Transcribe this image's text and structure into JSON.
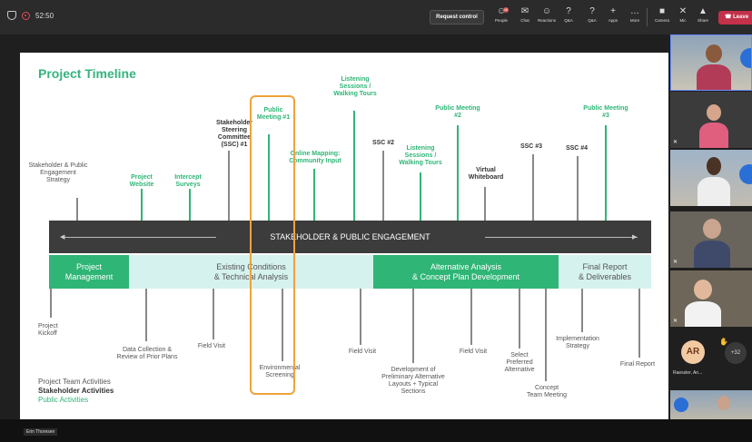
{
  "topbar": {
    "timer": "52:50",
    "request_control": "Request control",
    "buttons": [
      {
        "label": "People",
        "icon": "people-icon",
        "glyph": "☺",
        "badge": "40"
      },
      {
        "label": "Chat",
        "icon": "chat-icon",
        "glyph": "✉"
      },
      {
        "label": "Reactions",
        "icon": "reactions-icon",
        "glyph": "☺"
      },
      {
        "label": "Q&A",
        "icon": "qa-icon",
        "glyph": "?"
      },
      {
        "label": "Q&A",
        "icon": "qa-icon",
        "glyph": "?"
      },
      {
        "label": "Apps",
        "icon": "apps-icon",
        "glyph": "+"
      },
      {
        "label": "More",
        "icon": "more-icon",
        "glyph": "…"
      },
      {
        "label": "Camera",
        "icon": "camera-icon",
        "glyph": "■"
      },
      {
        "label": "Mic",
        "icon": "mic-off-icon",
        "glyph": "✕"
      },
      {
        "label": "Share",
        "icon": "share-icon",
        "glyph": "▲"
      }
    ],
    "leave": "Leave"
  },
  "slide": {
    "title": "Project Timeline",
    "band_text": "STAKEHOLDER & PUBLIC ENGAGEMENT",
    "above": [
      {
        "text": "Stakeholder & Public\nEngagement\nStrategy",
        "style": "n"
      },
      {
        "text": "Project\nWebsite",
        "style": "g"
      },
      {
        "text": "Intercept\nSurveys",
        "style": "g"
      },
      {
        "text": "Stakeholder\nSteering\nCommittee\n(SSC) #1",
        "style": "k"
      },
      {
        "text": "Public\nMeeting #1",
        "style": "g"
      },
      {
        "text": "Online Mapping:\nCommunity Input",
        "style": "g"
      },
      {
        "text": "Listening\nSessions /\nWalking Tours",
        "style": "g"
      },
      {
        "text": "SSC #2",
        "style": "k"
      },
      {
        "text": "Listening\nSessions /\nWalking Tours",
        "style": "g"
      },
      {
        "text": "Public Meeting\n#2",
        "style": "g"
      },
      {
        "text": "Virtual\nWhiteboard",
        "style": "k"
      },
      {
        "text": "SSC #3",
        "style": "k"
      },
      {
        "text": "SSC #4",
        "style": "k"
      },
      {
        "text": "Public Meeting\n#3",
        "style": "g"
      }
    ],
    "phases": [
      {
        "label": "Project\nManagement",
        "bg": "#2fb576",
        "fg": "#ffffff"
      },
      {
        "label": "Existing Conditions\n& Technical Analysis",
        "bg": "#d6f2ee",
        "fg": "#555555"
      },
      {
        "label": "Alternative Analysis\n& Concept Plan Development",
        "bg": "#2fb576",
        "fg": "#ffffff"
      },
      {
        "label": "Final Report\n& Deliverables",
        "bg": "#d6f2ee",
        "fg": "#555555"
      }
    ],
    "below": [
      {
        "text": "Project\nKickoff"
      },
      {
        "text": "Data Collection &\nReview of Prior Plans"
      },
      {
        "text": "Field Visit"
      },
      {
        "text": "Environmental\nScreening"
      },
      {
        "text": "Field Visit"
      },
      {
        "text": "Development of\nPreliminary Alternative\nLayouts + Typical\nSections"
      },
      {
        "text": "Field Visit"
      },
      {
        "text": "Select\nPreferred\nAlternative"
      },
      {
        "text": "Concept\nTeam Meeting"
      },
      {
        "text": "Implementation\nStrategy"
      },
      {
        "text": "Final Report"
      }
    ],
    "legend": {
      "team": "Project Team Activities",
      "stakeholder": "Stakeholder Activities",
      "public": "Public Activities"
    }
  },
  "gallery": {
    "avatar_initials": "AR",
    "avatar_name": "Raessler, An...",
    "more_count": "+32"
  },
  "speaker_name": "Erin Thoresen",
  "colors": {
    "accent_green": "#2fb576",
    "leave_red": "#c4314b",
    "highlight_orange": "#f0a23b"
  }
}
